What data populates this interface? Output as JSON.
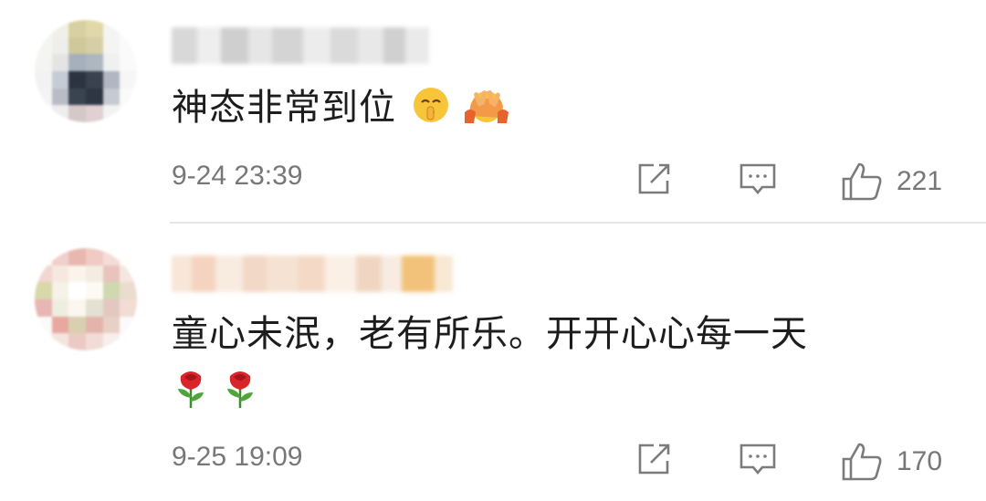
{
  "comments": [
    {
      "text": "神态非常到位",
      "time": "9-24 23:39",
      "likes": "221",
      "emojis": [
        "shushing-face-emoji",
        "peace-hands-emoji"
      ]
    },
    {
      "text": "童心未泯，老有所乐。开开心心每一天",
      "time": "9-25 19:09",
      "likes": "170",
      "emojis": [
        "rose-emoji",
        "rose-emoji"
      ]
    }
  ],
  "colors": {
    "text": "#1d1d1d",
    "meta": "#777777",
    "divider": "#e6e6e6"
  },
  "icons": [
    "share-icon",
    "comment-icon",
    "like-icon"
  ]
}
